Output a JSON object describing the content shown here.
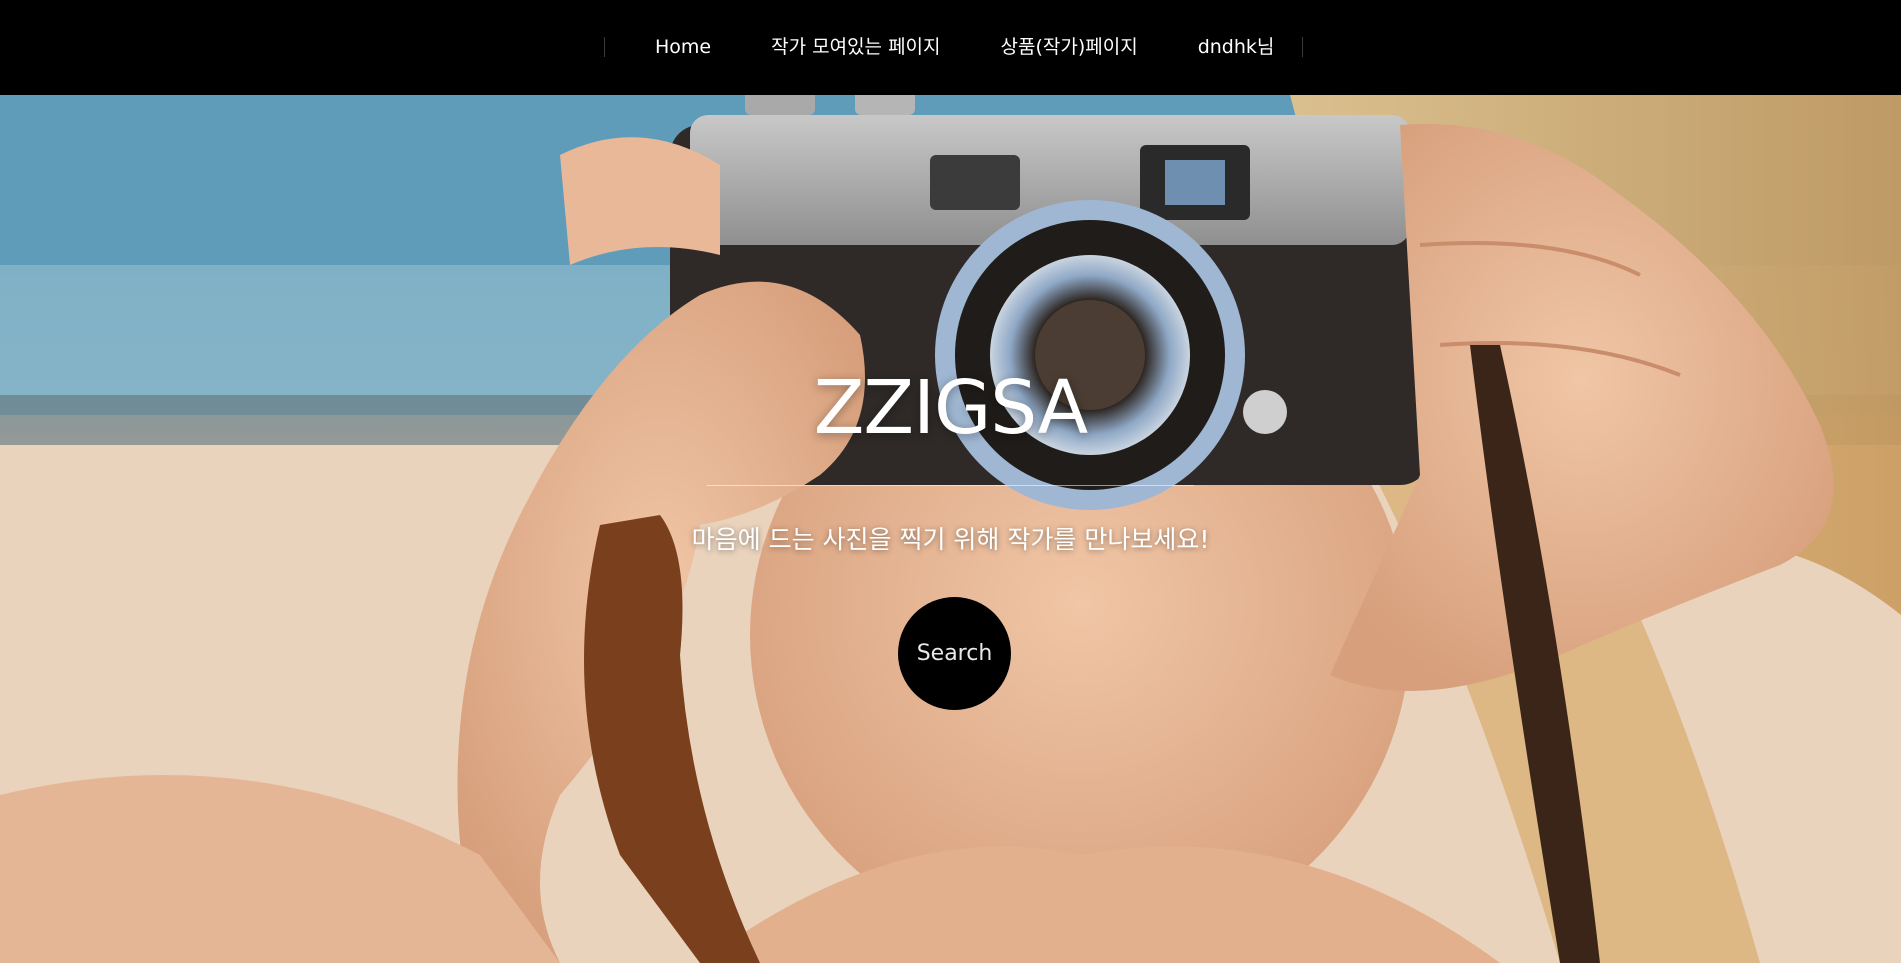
{
  "nav": {
    "items": [
      {
        "label": "Home"
      },
      {
        "label": "작가 모여있는 페이지"
      },
      {
        "label": "상품(작가)페이지"
      },
      {
        "label": "dndhk님"
      }
    ]
  },
  "hero": {
    "title": "ZZIGSA",
    "subtitle": "마음에 드는 사진을 찍기 위해 작가를 만나보세요!",
    "search_label": "Search",
    "image_icon": "camera-photo-background"
  },
  "colors": {
    "nav_bg": "#000000",
    "nav_text": "#ffffff",
    "button_bg": "#000000",
    "button_text": "#e8e8e8"
  }
}
